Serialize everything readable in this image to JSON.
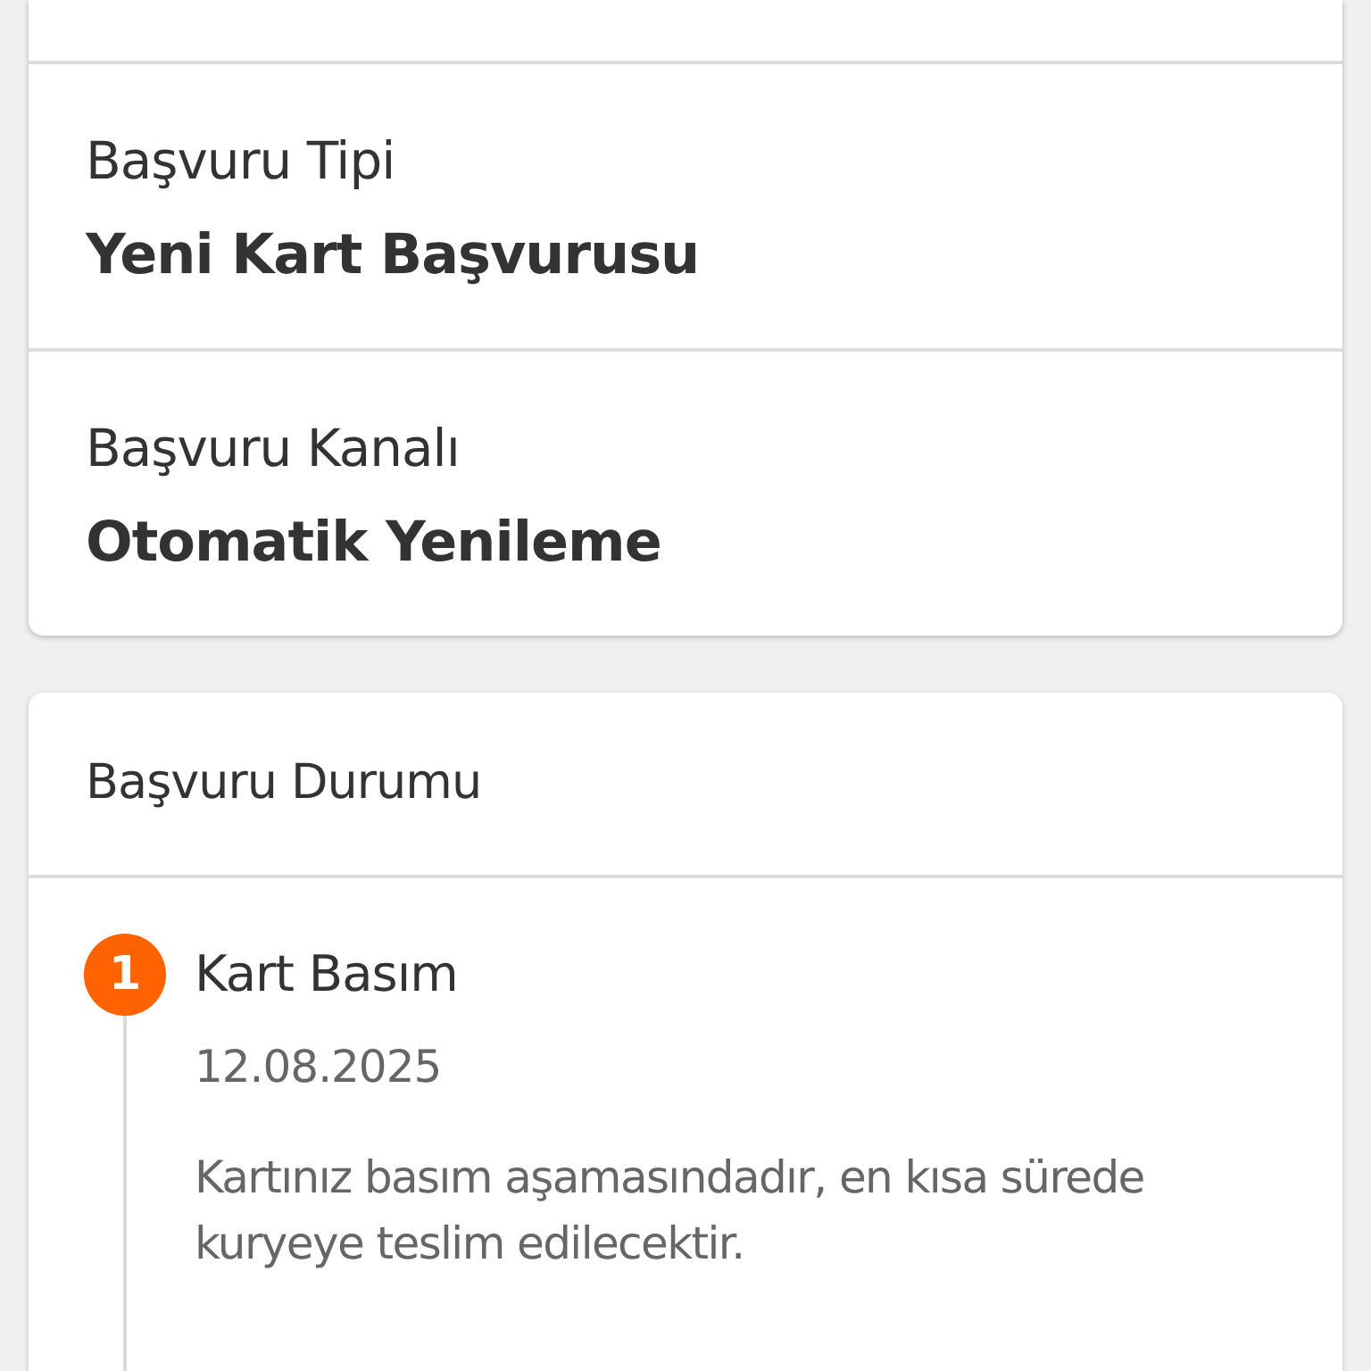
{
  "details": [
    {
      "label": "Başvuru Tipi",
      "value": "Yeni Kart Başvurusu"
    },
    {
      "label": "Başvuru Kanalı",
      "value": "Otomatik Yenileme"
    }
  ],
  "status": {
    "title": "Başvuru Durumu",
    "steps": [
      {
        "number": "1",
        "title": "Kart Basım",
        "date": "12.08.2025",
        "description": "Kartınız basım aşamasındadır, en kısa sürede kuryeye teslim edilecektir."
      }
    ]
  }
}
